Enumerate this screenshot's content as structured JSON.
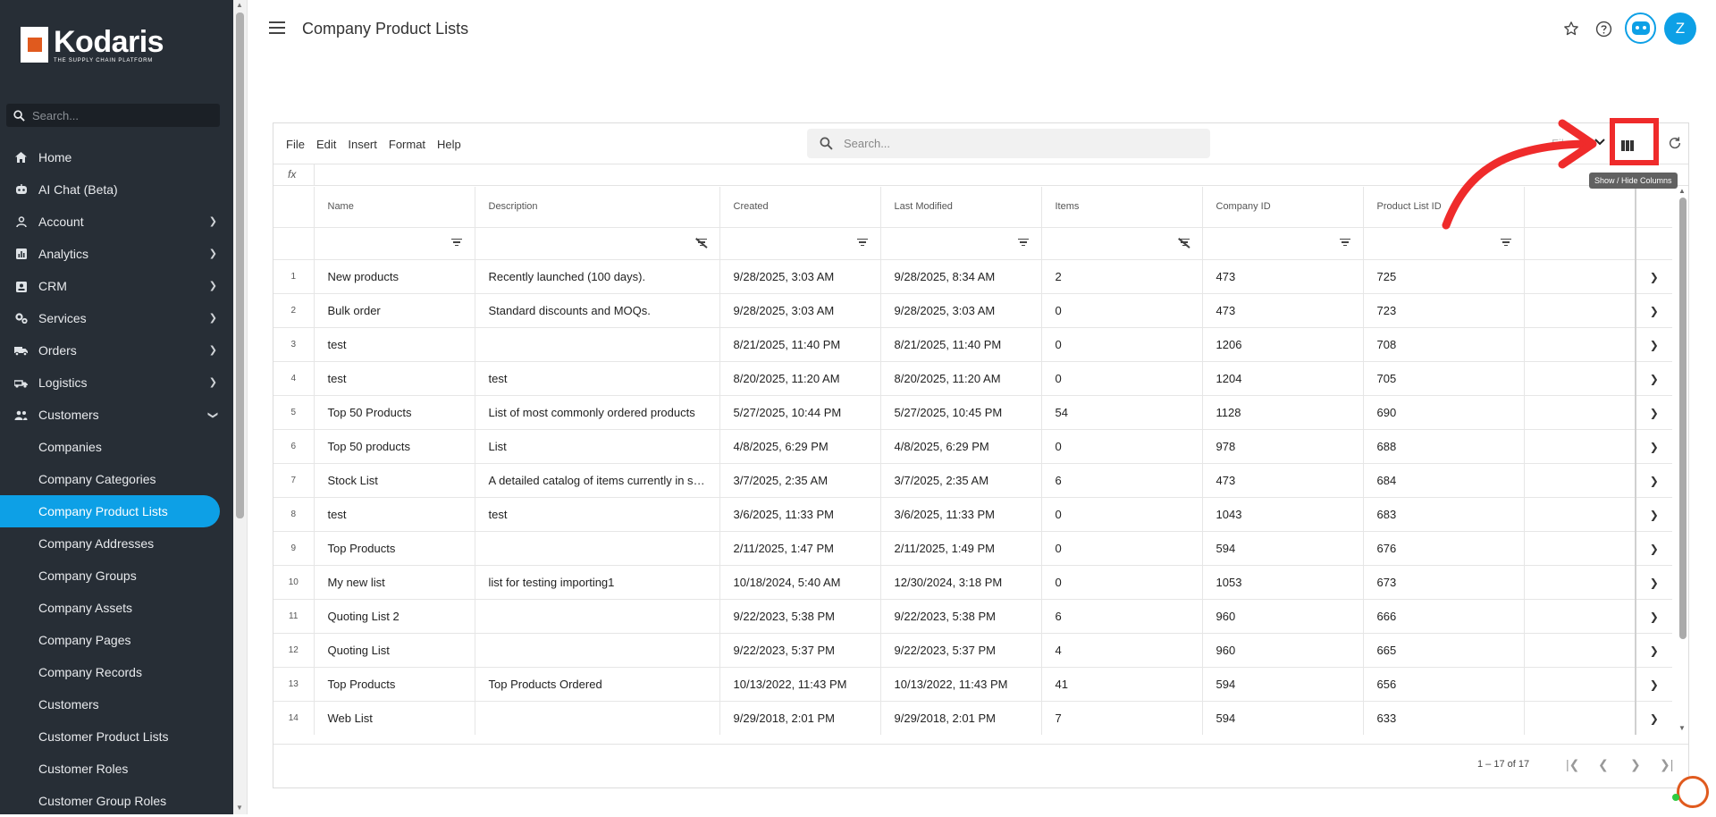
{
  "sidebar": {
    "logo_name": "Kodaris",
    "logo_tagline": "THE SUPPLY CHAIN PLATFORM",
    "search_placeholder": "Search...",
    "items": [
      {
        "label": "Home",
        "icon": "home-icon"
      },
      {
        "label": "AI Chat (Beta)",
        "icon": "robot-icon"
      },
      {
        "label": "Account",
        "icon": "person-icon"
      },
      {
        "label": "Analytics",
        "icon": "chart-icon"
      },
      {
        "label": "CRM",
        "icon": "contact-card-icon"
      },
      {
        "label": "Services",
        "icon": "gears-icon"
      },
      {
        "label": "Orders",
        "icon": "truck-icon"
      },
      {
        "label": "Logistics",
        "icon": "delivery-icon"
      },
      {
        "label": "Customers",
        "icon": "people-icon"
      }
    ],
    "sub_items": [
      "Companies",
      "Company Categories",
      "Company Product Lists",
      "Company Addresses",
      "Company Groups",
      "Company Assets",
      "Company Pages",
      "Company Records",
      "Customers",
      "Customer Product Lists",
      "Customer Roles",
      "Customer Group Roles"
    ],
    "active_sub_item": "Company Product Lists"
  },
  "header": {
    "title": "Company Product Lists",
    "avatar_initial": "Z"
  },
  "toolbar": {
    "menus": [
      "File",
      "Edit",
      "Insert",
      "Format",
      "Help"
    ],
    "search_placeholder": "Search...",
    "filter_label": "Fil",
    "tooltip": "Show / Hide Columns",
    "fx_label": "fx"
  },
  "table": {
    "columns": [
      "Name",
      "Description",
      "Created",
      "Last Modified",
      "Items",
      "Company ID",
      "Product List ID"
    ],
    "rows": [
      {
        "num": "1",
        "name": "New products",
        "description": "Recently launched (100 days).",
        "created": "9/28/2025, 3:03 AM",
        "modified": "9/28/2025, 8:34 AM",
        "items": "2",
        "company_id": "473",
        "list_id": "725"
      },
      {
        "num": "2",
        "name": "Bulk order",
        "description": "Standard discounts and MOQs.",
        "created": "9/28/2025, 3:03 AM",
        "modified": "9/28/2025, 3:03 AM",
        "items": "0",
        "company_id": "473",
        "list_id": "723"
      },
      {
        "num": "3",
        "name": "test",
        "description": "",
        "created": "8/21/2025, 11:40 PM",
        "modified": "8/21/2025, 11:40 PM",
        "items": "0",
        "company_id": "1206",
        "list_id": "708"
      },
      {
        "num": "4",
        "name": "test",
        "description": "test",
        "created": "8/20/2025, 11:20 AM",
        "modified": "8/20/2025, 11:20 AM",
        "items": "0",
        "company_id": "1204",
        "list_id": "705"
      },
      {
        "num": "5",
        "name": "Top 50 Products",
        "description": "List of most commonly ordered products",
        "created": "5/27/2025, 10:44 PM",
        "modified": "5/27/2025, 10:45 PM",
        "items": "54",
        "company_id": "1128",
        "list_id": "690"
      },
      {
        "num": "6",
        "name": "Top 50 products",
        "description": "List",
        "created": "4/8/2025, 6:29 PM",
        "modified": "4/8/2025, 6:29 PM",
        "items": "0",
        "company_id": "978",
        "list_id": "688"
      },
      {
        "num": "7",
        "name": "Stock List",
        "description": "A detailed catalog of items currently in st...",
        "created": "3/7/2025, 2:35 AM",
        "modified": "3/7/2025, 2:35 AM",
        "items": "6",
        "company_id": "473",
        "list_id": "684"
      },
      {
        "num": "8",
        "name": "test",
        "description": "test",
        "created": "3/6/2025, 11:33 PM",
        "modified": "3/6/2025, 11:33 PM",
        "items": "0",
        "company_id": "1043",
        "list_id": "683"
      },
      {
        "num": "9",
        "name": "Top Products",
        "description": "",
        "created": "2/11/2025, 1:47 PM",
        "modified": "2/11/2025, 1:49 PM",
        "items": "0",
        "company_id": "594",
        "list_id": "676"
      },
      {
        "num": "10",
        "name": "My new list",
        "description": "list for testing importing1",
        "created": "10/18/2024, 5:40 AM",
        "modified": "12/30/2024, 3:18 PM",
        "items": "0",
        "company_id": "1053",
        "list_id": "673"
      },
      {
        "num": "11",
        "name": "Quoting List 2",
        "description": "",
        "created": "9/22/2023, 5:38 PM",
        "modified": "9/22/2023, 5:38 PM",
        "items": "6",
        "company_id": "960",
        "list_id": "666"
      },
      {
        "num": "12",
        "name": "Quoting List",
        "description": "",
        "created": "9/22/2023, 5:37 PM",
        "modified": "9/22/2023, 5:37 PM",
        "items": "4",
        "company_id": "960",
        "list_id": "665"
      },
      {
        "num": "13",
        "name": "Top Products",
        "description": "Top Products Ordered",
        "created": "10/13/2022, 11:43 PM",
        "modified": "10/13/2022, 11:43 PM",
        "items": "41",
        "company_id": "594",
        "list_id": "656"
      },
      {
        "num": "14",
        "name": "Web List",
        "description": "",
        "created": "9/29/2018, 2:01 PM",
        "modified": "9/29/2018, 2:01 PM",
        "items": "7",
        "company_id": "594",
        "list_id": "633"
      }
    ]
  },
  "footer": {
    "page_info": "1 – 17 of 17"
  },
  "colors": {
    "sidebar_bg": "#272e36",
    "accent": "#0da0e6",
    "brand_orange": "#e05a1e",
    "annotation_red": "#ef2b2b"
  }
}
